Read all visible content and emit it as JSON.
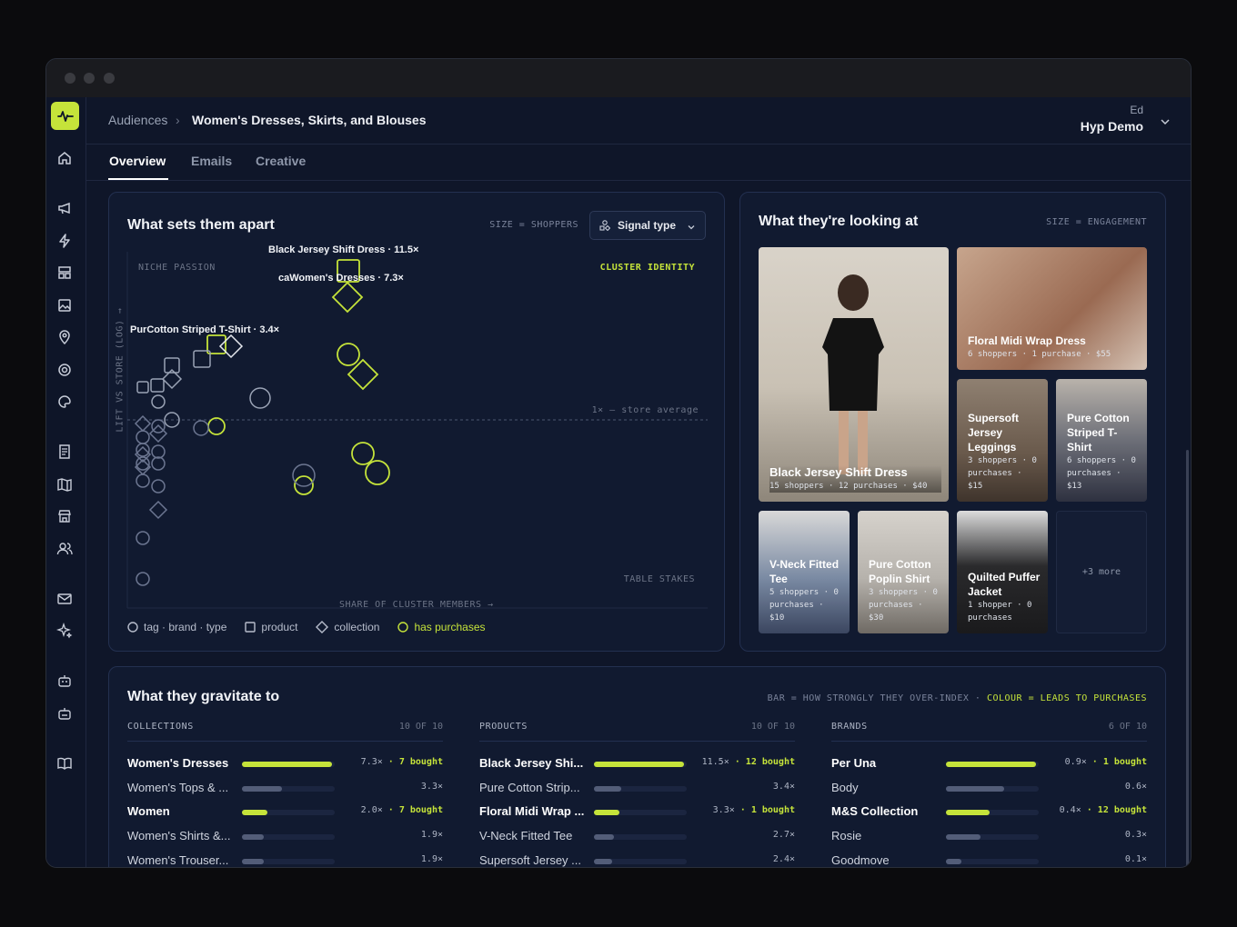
{
  "app": {
    "accent": "#c5e33a",
    "breadcrumb": {
      "parent": "Audiences",
      "separator": "›",
      "current": "Women's Dresses, Skirts, and Blouses"
    },
    "user": {
      "small": "Ed",
      "name": "Hyp Demo"
    },
    "tabs": [
      "Overview",
      "Emails",
      "Creative"
    ],
    "active_tab": "Overview",
    "rail_icons": [
      "pulse-logo-icon",
      "home-icon",
      "megaphone-icon",
      "bolt-icon",
      "layout-icon",
      "gallery-icon",
      "location-pin-icon",
      "target-icon",
      "palette-icon",
      "document-icon",
      "map-icon",
      "store-icon",
      "users-icon",
      "mail-icon",
      "sparkle-icon",
      "bot-icon",
      "bot-alt-icon",
      "book-icon"
    ]
  },
  "apart": {
    "title": "What sets them apart",
    "size_note": "SIZE = SHOPPERS",
    "signal_button": "Signal type",
    "y_axis": "LIFT VS STORE (LOG) →",
    "x_axis": "SHARE OF CLUSTER MEMBERS →",
    "quadrant_tl": "NICHE PASSION",
    "quadrant_tr": "CLUSTER IDENTITY",
    "quadrant_br": "TABLE STAKES",
    "baseline": "1× — store average",
    "labels": {
      "top": "Black Jersey Shift Dress · 11.5×",
      "second": "caWomen's Dresses · 7.3×",
      "third": "PurCotton Striped T-Shirt · 3.4×"
    },
    "legend": [
      {
        "shape": "circle",
        "label": "tag · brand · type"
      },
      {
        "shape": "square",
        "label": "product"
      },
      {
        "shape": "diamond",
        "label": "collection"
      },
      {
        "shape": "circle-accent",
        "label": "has purchases"
      }
    ]
  },
  "looking": {
    "title": "What they're looking at",
    "size_note": "SIZE = ENGAGEMENT",
    "tiles": [
      {
        "title": "Black Jersey Shift Dress",
        "sub": "15 shoppers · 12 purchases · $40"
      },
      {
        "title": "Floral Midi Wrap Dress",
        "sub": "6 shoppers · 1 purchase · $55"
      },
      {
        "title": "Supersoft Jersey Leggings",
        "sub": "3 shoppers · 0 purchases · $15"
      },
      {
        "title": "Pure Cotton Striped T-Shirt",
        "sub": "6 shoppers · 0 purchases · $13"
      },
      {
        "title": "V-Neck Fitted Tee",
        "sub": "5 shoppers · 0 purchases · $10"
      },
      {
        "title": "Pure Cotton Poplin Shirt",
        "sub": "3 shoppers · 0 purchases · $30"
      },
      {
        "title": "Quilted Puffer Jacket",
        "sub": "1 shopper · 0 purchases"
      }
    ],
    "more": "+3 more"
  },
  "gravitate": {
    "title": "What they gravitate to",
    "note_plain": "BAR = HOW STRONGLY THEY OVER-INDEX ·",
    "note_accent": "COLOUR = LEADS TO PURCHASES",
    "columns": [
      {
        "heading": "COLLECTIONS",
        "count": "10 OF 10",
        "rows": [
          {
            "name": "Women's Dresses",
            "lift": "7.3×",
            "bought": "· 7 bought",
            "level": 0.97,
            "hit": true
          },
          {
            "name": "Women's Tops & ...",
            "lift": "3.3×",
            "bought": "",
            "level": 0.43,
            "hit": false
          },
          {
            "name": "Women",
            "lift": "2.0×",
            "bought": "· 7 bought",
            "level": 0.27,
            "hit": true
          },
          {
            "name": "Women's Shirts &...",
            "lift": "1.9×",
            "bought": "",
            "level": 0.24,
            "hit": false
          },
          {
            "name": "Women's Trouser...",
            "lift": "1.9×",
            "bought": "",
            "level": 0.24,
            "hit": false
          }
        ]
      },
      {
        "heading": "PRODUCTS",
        "count": "10 OF 10",
        "rows": [
          {
            "name": "Black Jersey Shi...",
            "lift": "11.5×",
            "bought": "· 12 bought",
            "level": 0.97,
            "hit": true
          },
          {
            "name": "Pure Cotton Strip...",
            "lift": "3.4×",
            "bought": "",
            "level": 0.29,
            "hit": false
          },
          {
            "name": "Floral Midi Wrap ...",
            "lift": "3.3×",
            "bought": "· 1 bought",
            "level": 0.27,
            "hit": true
          },
          {
            "name": "V-Neck Fitted Tee",
            "lift": "2.7×",
            "bought": "",
            "level": 0.22,
            "hit": false
          },
          {
            "name": "Supersoft Jersey ...",
            "lift": "2.4×",
            "bought": "",
            "level": 0.2,
            "hit": false
          }
        ]
      },
      {
        "heading": "BRANDS",
        "count": "6 OF 10",
        "rows": [
          {
            "name": "Per Una",
            "lift": "0.9×",
            "bought": "· 1 bought",
            "level": 0.97,
            "hit": true
          },
          {
            "name": "Body",
            "lift": "0.6×",
            "bought": "",
            "level": 0.63,
            "hit": false
          },
          {
            "name": "M&S Collection",
            "lift": "0.4×",
            "bought": "· 12 bought",
            "level": 0.47,
            "hit": true
          },
          {
            "name": "Rosie",
            "lift": "0.3×",
            "bought": "",
            "level": 0.37,
            "hit": false
          },
          {
            "name": "Goodmove",
            "lift": "0.1×",
            "bought": "",
            "level": 0.17,
            "hit": false
          }
        ]
      }
    ]
  }
}
